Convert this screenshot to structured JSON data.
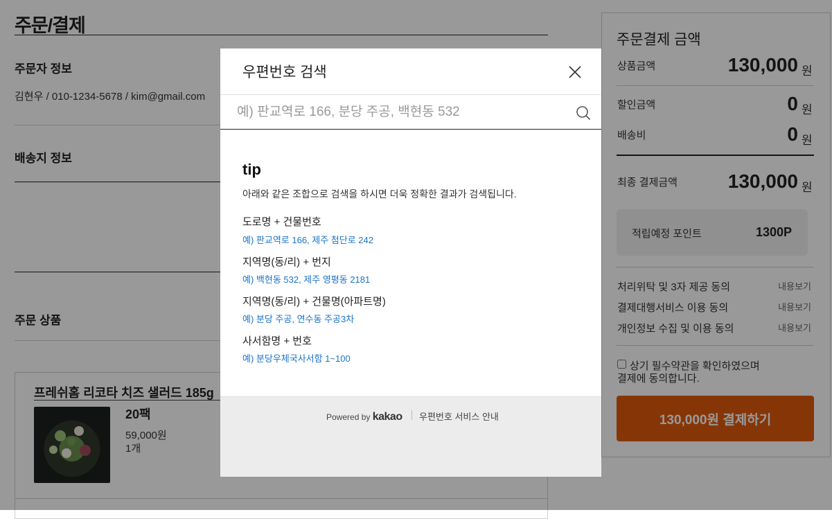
{
  "page": {
    "title": "주문/결제"
  },
  "orderer": {
    "title": "주문자 정보",
    "info": "김현우 / 010-1234-5678 / kim@gmail.com"
  },
  "shipping": {
    "title": "배송지 정보"
  },
  "products": {
    "title": "주문 상품",
    "item": {
      "name": "프레쉬홈 리코타 치즈 샐러드 185g",
      "option": "20팩",
      "price": "59,000원",
      "qty": "1개"
    }
  },
  "summary": {
    "title": "주문결제 금액",
    "product_amount_label": "상품금액",
    "product_amount": "130,000",
    "discount_label": "할인금액",
    "discount": "0",
    "shipping_label": "배송비",
    "shipping_fee": "0",
    "final_label": "최종 결제금액",
    "final_amount": "130,000",
    "currency": "원",
    "points_label": "적립예정 포인트",
    "points": "1300P",
    "terms": [
      {
        "label": "처리위탁 및 3자 제공 동의",
        "link": "내용보기"
      },
      {
        "label": "결제대행서비스 이용 동의",
        "link": "내용보기"
      },
      {
        "label": "개인정보 수집 및 이용 동의",
        "link": "내용보기"
      }
    ],
    "agree_line1": "상기 필수약관을 확인하였으며",
    "agree_line2": "결제에 동의합니다.",
    "pay_button": "130,000원 결제하기",
    "accent_color": "#e05a0a"
  },
  "postcode_modal": {
    "title": "우편번호 검색",
    "search_placeholder": "예) 판교역로 166, 분당 주공, 백현동 532",
    "tip_title": "tip",
    "tip_desc": "아래와 같은 조합으로 검색을 하시면 더욱 정확한 결과가 검색됩니다.",
    "tips": [
      {
        "head": "도로명 + 건물번호",
        "example": "예) 판교역로 166,  제주 첨단로 242"
      },
      {
        "head": "지역명(동/리) + 번지",
        "example": "예) 백현동 532,  제주 영평동 2181"
      },
      {
        "head": "지역명(동/리) + 건물명(아파트명)",
        "example": "예) 분당 주공,  연수동 주공3차"
      },
      {
        "head": "사서함명 + 번호",
        "example": "예) 분당우체국사서함 1~100"
      }
    ],
    "powered_by": "Powered by",
    "brand": "kakao",
    "service_link": "우편번호 서비스 안내"
  }
}
